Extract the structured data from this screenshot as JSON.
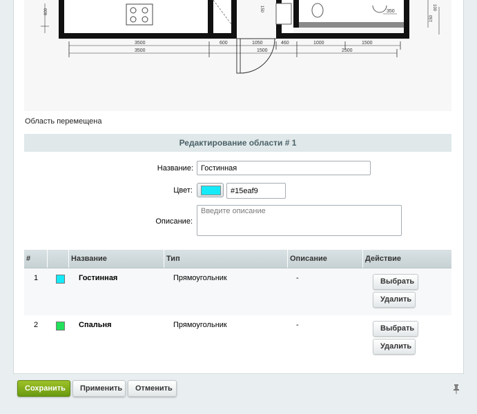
{
  "floor_plan": {
    "dims_small": [
      "600",
      "1050",
      "460",
      "1000",
      "1500",
      "350",
      "100",
      "150",
      "150"
    ],
    "dims_large": [
      "3500",
      "3500",
      "1500",
      "2500"
    ]
  },
  "status_message": "Область перемещена",
  "edit": {
    "header": "Редактирование области # 1",
    "name_label": "Название:",
    "name_value": "Гостинная",
    "color_label": "Цвет:",
    "color_value": "#15eaf9",
    "description_label": "Описание:",
    "description_placeholder": "Введите описание"
  },
  "table": {
    "headers": [
      "#",
      "",
      "Название",
      "Тип",
      "Описание",
      "Действие"
    ],
    "rows": [
      {
        "num": "1",
        "color": "#15eaf9",
        "name": "Гостинная",
        "type": "Прямоугольник",
        "description": "-",
        "select": "Выбрать",
        "delete": "Удалить"
      },
      {
        "num": "2",
        "color": "#22e05a",
        "name": "Спальня",
        "type": "Прямоугольник",
        "description": "-",
        "select": "Выбрать",
        "delete": "Удалить"
      }
    ]
  },
  "footer": {
    "save": "Сохранить",
    "apply": "Применить",
    "cancel": "Отменить"
  },
  "colors": {
    "save_button": "#7aab18",
    "header_bg": "#e0e8ea"
  },
  "icons": {
    "pin": "pin-icon"
  }
}
